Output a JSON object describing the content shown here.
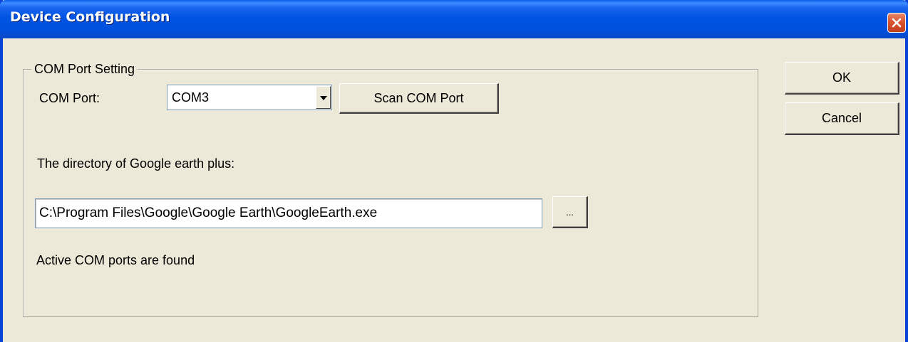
{
  "window": {
    "title": "Device Configuration",
    "close_icon": "close-icon",
    "colors": {
      "titlebar": "#0054e3",
      "close_button": "#d9532f",
      "dialog_background": "#ece9d8"
    }
  },
  "com_group": {
    "legend": "COM Port Setting",
    "com_port_label": "COM Port:",
    "com_port_selected": "COM3",
    "dropdown_icon": "chevron-down-icon",
    "scan_button": "Scan COM Port",
    "directory_label": "The directory of Google earth plus:",
    "directory_value": "C:\\Program Files\\Google\\Google Earth\\GoogleEarth.exe",
    "browse_button": "...",
    "status_text": "Active COM ports are found"
  },
  "actions": {
    "ok": "OK",
    "cancel": "Cancel"
  }
}
